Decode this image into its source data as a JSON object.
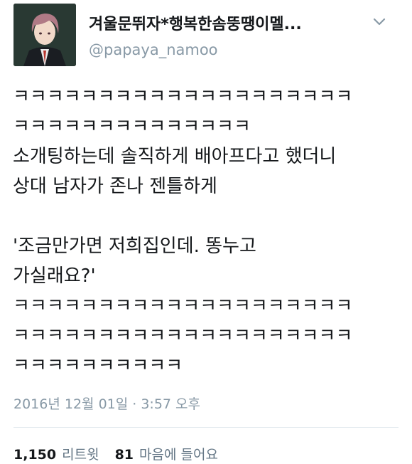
{
  "author": {
    "display_name": "겨울문뛰자*행복한솜뚱땡이멜...",
    "handle": "@papaya_namoo"
  },
  "icons": {
    "avatar": "avatar-illustration",
    "menu": "chevron-down-icon"
  },
  "tweet": {
    "lines": [
      "ㅋㅋㅋㅋㅋㅋㅋㅋㅋㅋㅋㅋㅋㅋㅋㅋㅋㅋㅋㅋ",
      "ㅋㅋㅋㅋㅋㅋㅋㅋㅋㅋㅋㅋㅋㅋ",
      "소개팅하는데 솔직하게 배아프다고 했더니",
      "상대 남자가 존나 젠틀하게",
      "",
      "'조금만가면 저희집인데. 똥누고",
      "가실래요?'",
      "ㅋㅋㅋㅋㅋㅋㅋㅋㅋㅋㅋㅋㅋㅋㅋㅋㅋㅋㅋㅋ",
      "ㅋㅋㅋㅋㅋㅋㅋㅋㅋㅋㅋㅋㅋㅋㅋㅋㅋㅋㅋㅋ",
      "ㅋㅋㅋㅋㅋㅋㅋㅋㅋㅋ"
    ],
    "timestamp": "2016년 12월 01일 · 3:57 오후"
  },
  "stats": {
    "retweets_count": "1,150",
    "retweets_label": "리트윗",
    "likes_count": "81",
    "likes_label": "마음에 들어요"
  },
  "colors": {
    "text": "#14171a",
    "muted": "#8899a6",
    "divider": "#e1e8ed"
  }
}
